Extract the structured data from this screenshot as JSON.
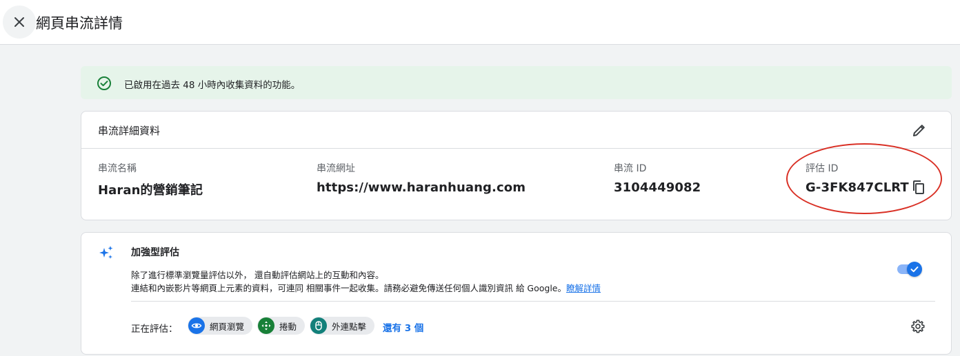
{
  "header": {
    "title": "網頁串流詳情",
    "close_icon": "close-icon"
  },
  "banner": {
    "icon": "check-circle-icon",
    "text": "已啟用在過去 48 小時內收集資料的功能。",
    "color": "#e6f4ea"
  },
  "details": {
    "title": "串流詳細資料",
    "edit_icon": "pencil-icon",
    "fields": [
      {
        "label": "串流名稱",
        "value": "Haran的營銷筆記"
      },
      {
        "label": "串流網址",
        "value": "https://www.haranhuang.com"
      },
      {
        "label": "串流 ID",
        "value": "3104449082"
      },
      {
        "label": "評估 ID",
        "value": "G-3FK847CLRT"
      }
    ],
    "copy_icon": "copy-icon",
    "annotation_color": "#d93025"
  },
  "enhanced": {
    "icon": "sparkle-icon",
    "title": "加強型評估",
    "desc1": "除了進行標準瀏覽量評估以外， 還自動評估網站上的互動和內容。",
    "desc2": "連結和內嵌影片等網頁上元素的資料，可連同 相關事件一起收集。請務必避免傳送任何個人識別資訊 給 Google。",
    "learn_more": "瞭解詳情",
    "toggle_on": true,
    "measuring_label": "正在評估：",
    "chips": [
      {
        "label": "網頁瀏覽",
        "icon": "eye-icon",
        "color": "#1a73e8"
      },
      {
        "label": "捲動",
        "icon": "scroll-arrows-icon",
        "color": "#188038"
      },
      {
        "label": "外連點擊",
        "icon": "mouse-icon",
        "color": "#12807a"
      }
    ],
    "more": "還有 3 個",
    "settings_icon": "gear-icon"
  }
}
